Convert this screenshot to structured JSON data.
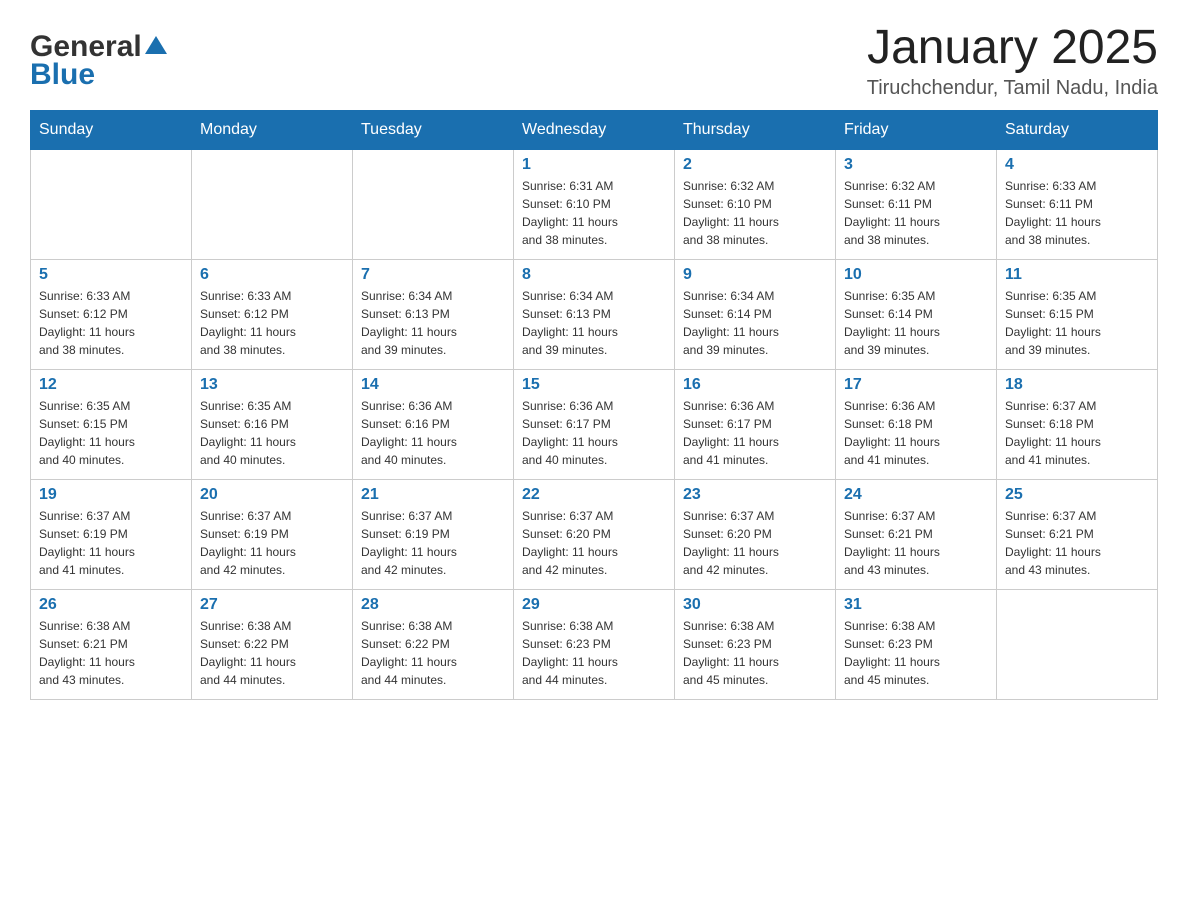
{
  "header": {
    "logo": {
      "text1": "General",
      "text2": "Blue"
    },
    "title": "January 2025",
    "location": "Tiruchchendur, Tamil Nadu, India"
  },
  "days_of_week": [
    "Sunday",
    "Monday",
    "Tuesday",
    "Wednesday",
    "Thursday",
    "Friday",
    "Saturday"
  ],
  "weeks": [
    [
      {
        "day": "",
        "info": ""
      },
      {
        "day": "",
        "info": ""
      },
      {
        "day": "",
        "info": ""
      },
      {
        "day": "1",
        "info": "Sunrise: 6:31 AM\nSunset: 6:10 PM\nDaylight: 11 hours\nand 38 minutes."
      },
      {
        "day": "2",
        "info": "Sunrise: 6:32 AM\nSunset: 6:10 PM\nDaylight: 11 hours\nand 38 minutes."
      },
      {
        "day": "3",
        "info": "Sunrise: 6:32 AM\nSunset: 6:11 PM\nDaylight: 11 hours\nand 38 minutes."
      },
      {
        "day": "4",
        "info": "Sunrise: 6:33 AM\nSunset: 6:11 PM\nDaylight: 11 hours\nand 38 minutes."
      }
    ],
    [
      {
        "day": "5",
        "info": "Sunrise: 6:33 AM\nSunset: 6:12 PM\nDaylight: 11 hours\nand 38 minutes."
      },
      {
        "day": "6",
        "info": "Sunrise: 6:33 AM\nSunset: 6:12 PM\nDaylight: 11 hours\nand 38 minutes."
      },
      {
        "day": "7",
        "info": "Sunrise: 6:34 AM\nSunset: 6:13 PM\nDaylight: 11 hours\nand 39 minutes."
      },
      {
        "day": "8",
        "info": "Sunrise: 6:34 AM\nSunset: 6:13 PM\nDaylight: 11 hours\nand 39 minutes."
      },
      {
        "day": "9",
        "info": "Sunrise: 6:34 AM\nSunset: 6:14 PM\nDaylight: 11 hours\nand 39 minutes."
      },
      {
        "day": "10",
        "info": "Sunrise: 6:35 AM\nSunset: 6:14 PM\nDaylight: 11 hours\nand 39 minutes."
      },
      {
        "day": "11",
        "info": "Sunrise: 6:35 AM\nSunset: 6:15 PM\nDaylight: 11 hours\nand 39 minutes."
      }
    ],
    [
      {
        "day": "12",
        "info": "Sunrise: 6:35 AM\nSunset: 6:15 PM\nDaylight: 11 hours\nand 40 minutes."
      },
      {
        "day": "13",
        "info": "Sunrise: 6:35 AM\nSunset: 6:16 PM\nDaylight: 11 hours\nand 40 minutes."
      },
      {
        "day": "14",
        "info": "Sunrise: 6:36 AM\nSunset: 6:16 PM\nDaylight: 11 hours\nand 40 minutes."
      },
      {
        "day": "15",
        "info": "Sunrise: 6:36 AM\nSunset: 6:17 PM\nDaylight: 11 hours\nand 40 minutes."
      },
      {
        "day": "16",
        "info": "Sunrise: 6:36 AM\nSunset: 6:17 PM\nDaylight: 11 hours\nand 41 minutes."
      },
      {
        "day": "17",
        "info": "Sunrise: 6:36 AM\nSunset: 6:18 PM\nDaylight: 11 hours\nand 41 minutes."
      },
      {
        "day": "18",
        "info": "Sunrise: 6:37 AM\nSunset: 6:18 PM\nDaylight: 11 hours\nand 41 minutes."
      }
    ],
    [
      {
        "day": "19",
        "info": "Sunrise: 6:37 AM\nSunset: 6:19 PM\nDaylight: 11 hours\nand 41 minutes."
      },
      {
        "day": "20",
        "info": "Sunrise: 6:37 AM\nSunset: 6:19 PM\nDaylight: 11 hours\nand 42 minutes."
      },
      {
        "day": "21",
        "info": "Sunrise: 6:37 AM\nSunset: 6:19 PM\nDaylight: 11 hours\nand 42 minutes."
      },
      {
        "day": "22",
        "info": "Sunrise: 6:37 AM\nSunset: 6:20 PM\nDaylight: 11 hours\nand 42 minutes."
      },
      {
        "day": "23",
        "info": "Sunrise: 6:37 AM\nSunset: 6:20 PM\nDaylight: 11 hours\nand 42 minutes."
      },
      {
        "day": "24",
        "info": "Sunrise: 6:37 AM\nSunset: 6:21 PM\nDaylight: 11 hours\nand 43 minutes."
      },
      {
        "day": "25",
        "info": "Sunrise: 6:37 AM\nSunset: 6:21 PM\nDaylight: 11 hours\nand 43 minutes."
      }
    ],
    [
      {
        "day": "26",
        "info": "Sunrise: 6:38 AM\nSunset: 6:21 PM\nDaylight: 11 hours\nand 43 minutes."
      },
      {
        "day": "27",
        "info": "Sunrise: 6:38 AM\nSunset: 6:22 PM\nDaylight: 11 hours\nand 44 minutes."
      },
      {
        "day": "28",
        "info": "Sunrise: 6:38 AM\nSunset: 6:22 PM\nDaylight: 11 hours\nand 44 minutes."
      },
      {
        "day": "29",
        "info": "Sunrise: 6:38 AM\nSunset: 6:23 PM\nDaylight: 11 hours\nand 44 minutes."
      },
      {
        "day": "30",
        "info": "Sunrise: 6:38 AM\nSunset: 6:23 PM\nDaylight: 11 hours\nand 45 minutes."
      },
      {
        "day": "31",
        "info": "Sunrise: 6:38 AM\nSunset: 6:23 PM\nDaylight: 11 hours\nand 45 minutes."
      },
      {
        "day": "",
        "info": ""
      }
    ]
  ]
}
